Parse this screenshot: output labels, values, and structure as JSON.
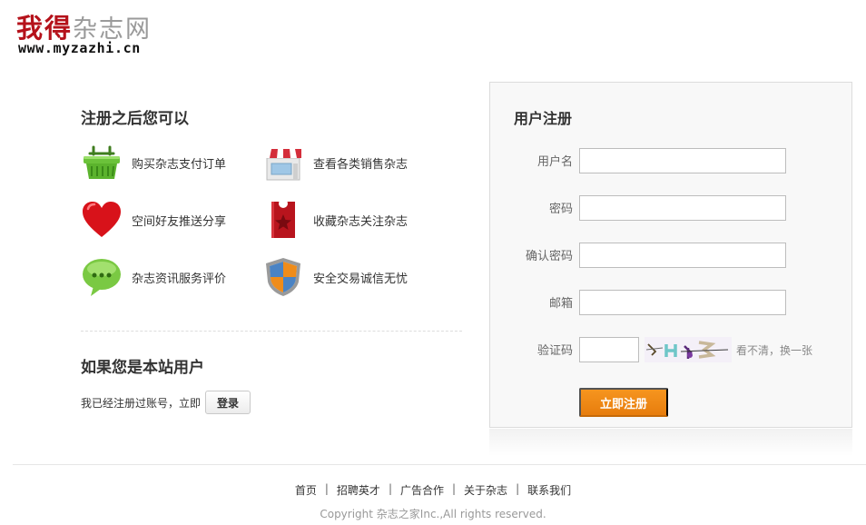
{
  "logo": {
    "brand_red": "我得",
    "brand_grey": "杂志网",
    "url": "www.myzazhi.cn"
  },
  "benefits": {
    "title": "注册之后您可以",
    "items": [
      {
        "label": "购买杂志支付订单",
        "icon": "shopping-basket-icon"
      },
      {
        "label": "查看各类销售杂志",
        "icon": "storefront-icon"
      },
      {
        "label": "空间好友推送分享",
        "icon": "heart-icon"
      },
      {
        "label": "收藏杂志关注杂志",
        "icon": "bookmark-ticket-icon"
      },
      {
        "label": "杂志资讯服务评价",
        "icon": "chat-bubble-icon"
      },
      {
        "label": "安全交易诚信无忧",
        "icon": "shield-icon"
      }
    ]
  },
  "member": {
    "title": "如果您是本站用户",
    "prompt": "我已经注册过账号，立即",
    "login_label": "登录"
  },
  "register": {
    "title": "用户注册",
    "fields": {
      "username": {
        "label": "用户名",
        "value": ""
      },
      "password": {
        "label": "密码",
        "value": ""
      },
      "confirm": {
        "label": "确认密码",
        "value": ""
      },
      "email": {
        "label": "邮箱",
        "value": ""
      },
      "captcha": {
        "label": "验证码",
        "value": ""
      }
    },
    "captcha_refresh": "看不清，换一张",
    "submit_label": "立即注册"
  },
  "footer": {
    "links": [
      "首页",
      "招聘英才",
      "广告合作",
      "关于杂志",
      "联系我们"
    ],
    "copyright": "Copyright 杂志之家Inc.,All rights reserved."
  },
  "colors": {
    "brand_red": "#b5121b",
    "accent_orange": "#f08a12"
  }
}
